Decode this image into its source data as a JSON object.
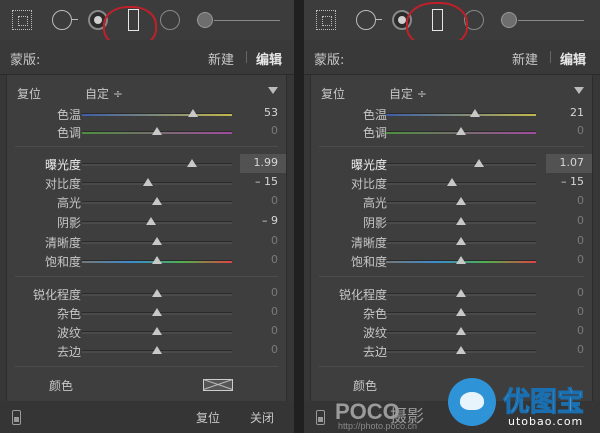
{
  "panels": [
    {
      "annotation": "1",
      "mask_label": "蒙版:",
      "new_label": "新建",
      "edit_label": "编辑",
      "reset_label": "复位",
      "preset_value": "自定 ÷",
      "color_label": "颜色",
      "footer_reset": "复位",
      "footer_close": "关闭",
      "sliders": [
        {
          "name": "色温",
          "value": "53",
          "pos": 0.74,
          "grad": "linear-gradient(90deg,#3c5ea8,#c2b64b)"
        },
        {
          "name": "色调",
          "value": "0",
          "pos": 0.5,
          "grad": "linear-gradient(90deg,#4c8f3f,#a24a9e)"
        },
        {
          "name": "曝光度",
          "value": "1.99",
          "pos": 0.73,
          "grad": "#4a4a4a"
        },
        {
          "name": "对比度",
          "value": "– 15",
          "pos": 0.44,
          "grad": "#4a4a4a"
        },
        {
          "name": "高光",
          "value": "0",
          "pos": 0.5,
          "grad": "#4a4a4a"
        },
        {
          "name": "阴影",
          "value": "– 9",
          "pos": 0.46,
          "grad": "#4a4a4a"
        },
        {
          "name": "清晰度",
          "value": "0",
          "pos": 0.5,
          "grad": "#4a4a4a"
        },
        {
          "name": "饱和度",
          "value": "0",
          "pos": 0.5,
          "grad": "linear-gradient(90deg,#777,#3a8bd0,#4fb04f,#d44)"
        },
        {
          "name": "锐化程度",
          "value": "0",
          "pos": 0.5,
          "grad": "#4a4a4a"
        },
        {
          "name": "杂色",
          "value": "0",
          "pos": 0.5,
          "grad": "#4a4a4a"
        },
        {
          "name": "波纹",
          "value": "0",
          "pos": 0.5,
          "grad": "#4a4a4a"
        },
        {
          "name": "去边",
          "value": "0",
          "pos": 0.5,
          "grad": "#4a4a4a"
        }
      ]
    },
    {
      "annotation": "2",
      "mask_label": "蒙版:",
      "new_label": "新建",
      "edit_label": "编辑",
      "reset_label": "复位",
      "preset_value": "自定 ÷",
      "color_label": "颜色",
      "sliders": [
        {
          "name": "色温",
          "value": "21",
          "pos": 0.59,
          "grad": "linear-gradient(90deg,#3c5ea8,#c2b64b)"
        },
        {
          "name": "色调",
          "value": "0",
          "pos": 0.5,
          "grad": "linear-gradient(90deg,#4c8f3f,#a24a9e)"
        },
        {
          "name": "曝光度",
          "value": "1.07",
          "pos": 0.62,
          "grad": "#4a4a4a"
        },
        {
          "name": "对比度",
          "value": "– 15",
          "pos": 0.44,
          "grad": "#4a4a4a"
        },
        {
          "name": "高光",
          "value": "0",
          "pos": 0.5,
          "grad": "#4a4a4a"
        },
        {
          "name": "阴影",
          "value": "0",
          "pos": 0.5,
          "grad": "#4a4a4a"
        },
        {
          "name": "清晰度",
          "value": "0",
          "pos": 0.5,
          "grad": "#4a4a4a"
        },
        {
          "name": "饱和度",
          "value": "0",
          "pos": 0.5,
          "grad": "linear-gradient(90deg,#777,#3a8bd0,#4fb04f,#d44)"
        },
        {
          "name": "锐化程度",
          "value": "0",
          "pos": 0.5,
          "grad": "#4a4a4a"
        },
        {
          "name": "杂色",
          "value": "0",
          "pos": 0.5,
          "grad": "#4a4a4a"
        },
        {
          "name": "波纹",
          "value": "0",
          "pos": 0.5,
          "grad": "#4a4a4a"
        },
        {
          "name": "去边",
          "value": "0",
          "pos": 0.5,
          "grad": "#4a4a4a"
        }
      ]
    }
  ],
  "watermark": {
    "poco": "POCO",
    "ying": "摄影",
    "url": "http://photo.poco.cn",
    "logo": "优图宝",
    "logo_sub": "utobao.com"
  },
  "colors": {
    "annotation": "#c0202a",
    "panel": "#373737",
    "logo_blue": "#2f93d8"
  }
}
